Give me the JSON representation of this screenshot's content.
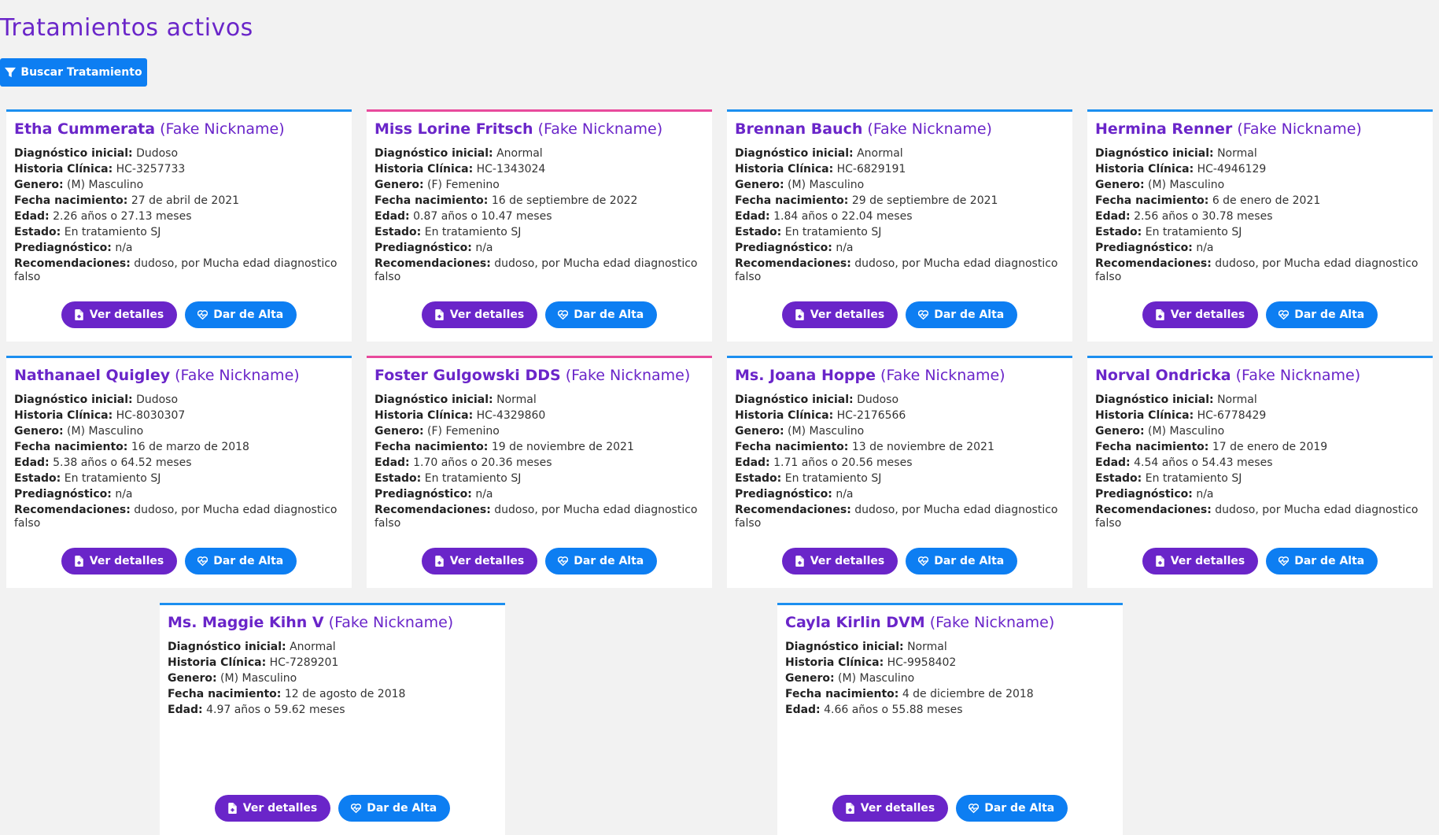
{
  "page": {
    "title": "Tratamientos activos",
    "search_button": "Buscar Tratamiento",
    "nickname": "(Fake Nickname)"
  },
  "labels": {
    "diagnostico": "Diagnóstico inicial:",
    "historia": "Historia Clínica:",
    "genero": "Genero:",
    "nacimiento": "Fecha nacimiento:",
    "edad": "Edad:",
    "estado": "Estado:",
    "prediagnostico": "Prediagnóstico:",
    "recomendaciones": "Recomendaciones:",
    "ver_detalles": "Ver detalles",
    "dar_alta": "Dar de Alta"
  },
  "colors": {
    "accent": "#6a25c9",
    "primary": "#0d7ef2",
    "male_border": "#1c8ff0",
    "female_border": "#e84a9c"
  },
  "patients": [
    {
      "name": "Etha Cummerata",
      "diagnostico": "Dudoso",
      "historia": "HC-3257733",
      "genero": "(M) Masculino",
      "nacimiento": "27 de abril de 2021",
      "edad": "2.26 años o 27.13 meses",
      "estado": "En tratamiento SJ",
      "prediagnostico": "n/a",
      "recomendaciones": "dudoso, por Mucha edad diagnostico falso"
    },
    {
      "name": "Miss Lorine Fritsch",
      "diagnostico": "Anormal",
      "historia": "HC-1343024",
      "genero": "(F) Femenino",
      "nacimiento": "16 de septiembre de 2022",
      "edad": "0.87 años o 10.47 meses",
      "estado": "En tratamiento SJ",
      "prediagnostico": "n/a",
      "recomendaciones": "dudoso, por Mucha edad diagnostico falso"
    },
    {
      "name": "Brennan Bauch",
      "diagnostico": "Anormal",
      "historia": "HC-6829191",
      "genero": "(M) Masculino",
      "nacimiento": "29 de septiembre de 2021",
      "edad": "1.84 años o 22.04 meses",
      "estado": "En tratamiento SJ",
      "prediagnostico": "n/a",
      "recomendaciones": "dudoso, por Mucha edad diagnostico falso"
    },
    {
      "name": "Hermina Renner",
      "diagnostico": "Normal",
      "historia": "HC-4946129",
      "genero": "(M) Masculino",
      "nacimiento": "6 de enero de 2021",
      "edad": "2.56 años o 30.78 meses",
      "estado": "En tratamiento SJ",
      "prediagnostico": "n/a",
      "recomendaciones": "dudoso, por Mucha edad diagnostico falso"
    },
    {
      "name": "Nathanael Quigley",
      "diagnostico": "Dudoso",
      "historia": "HC-8030307",
      "genero": "(M) Masculino",
      "nacimiento": "16 de marzo de 2018",
      "edad": "5.38 años o 64.52 meses",
      "estado": "En tratamiento SJ",
      "prediagnostico": "n/a",
      "recomendaciones": "dudoso, por Mucha edad diagnostico falso"
    },
    {
      "name": "Foster Gulgowski DDS",
      "diagnostico": "Normal",
      "historia": "HC-4329860",
      "genero": "(F) Femenino",
      "nacimiento": "19 de noviembre de 2021",
      "edad": "1.70 años o 20.36 meses",
      "estado": "En tratamiento SJ",
      "prediagnostico": "n/a",
      "recomendaciones": "dudoso, por Mucha edad diagnostico falso"
    },
    {
      "name": "Ms. Joana Hoppe",
      "diagnostico": "Dudoso",
      "historia": "HC-2176566",
      "genero": "(M) Masculino",
      "nacimiento": "13 de noviembre de 2021",
      "edad": "1.71 años o 20.56 meses",
      "estado": "En tratamiento SJ",
      "prediagnostico": "n/a",
      "recomendaciones": "dudoso, por Mucha edad diagnostico falso"
    },
    {
      "name": "Norval Ondricka",
      "diagnostico": "Normal",
      "historia": "HC-6778429",
      "genero": "(M) Masculino",
      "nacimiento": "17 de enero de 2019",
      "edad": "4.54 años o 54.43 meses",
      "estado": "En tratamiento SJ",
      "prediagnostico": "n/a",
      "recomendaciones": "dudoso, por Mucha edad diagnostico falso"
    },
    {
      "name": "Ms. Maggie Kihn V",
      "diagnostico": "Anormal",
      "historia": "HC-7289201",
      "genero": "(M) Masculino",
      "nacimiento": "12 de agosto de 2018",
      "edad": "4.97 años o 59.62 meses",
      "estado": "",
      "prediagnostico": "",
      "recomendaciones": ""
    },
    {
      "name": "Cayla Kirlin DVM",
      "diagnostico": "Normal",
      "historia": "HC-9958402",
      "genero": "(M) Masculino",
      "nacimiento": "4 de diciembre de 2018",
      "edad": "4.66 años o 55.88 meses",
      "estado": "",
      "prediagnostico": "",
      "recomendaciones": ""
    }
  ]
}
